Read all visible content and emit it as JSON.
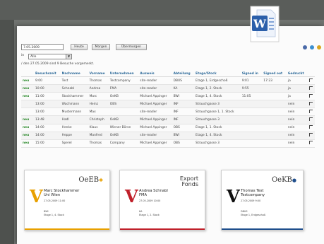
{
  "colors": {
    "badge_v_1": "#e8a000",
    "badge_v_2": "#c0202a",
    "badge_v_3": "#111111",
    "header_link": "#2f6b9a",
    "status_green": "#2c8a2c"
  },
  "icons": [
    "word-icon",
    "print-icon",
    "info-icon",
    "help-icon"
  ],
  "toolbar": {
    "date_value": "7.05.2009",
    "heute_label": "Heute",
    "morgen_label": "Morgen",
    "uebermorgen_label": "Übermorgen",
    "select_prefix": "in",
    "select_value": "Alle",
    "info_text": "/ den 27.05.2009 sind 9 Besuche vorgemerkt."
  },
  "table": {
    "headers": [
      "",
      "Besuchszeit",
      "Nachname",
      "Vorname",
      "Unternehmen",
      "Ausweis",
      "Abteilung",
      "Etage/Stock",
      "Signed in",
      "Signed out",
      "Gedruckt",
      ""
    ],
    "rows": [
      [
        "neu",
        "9:00",
        "Test",
        "Thomas",
        "Testcompany",
        "site-reader",
        "DBUS",
        "Etage 1, Erdgeschoß",
        "9:01",
        "17:23",
        "ja"
      ],
      [
        "neu",
        "10:00",
        "Schnabl",
        "Andrea",
        "FMA",
        "site-reader",
        "KA",
        "Etage 1, 2. Stock",
        "9:55",
        "",
        "ja"
      ],
      [
        "neu",
        "11:00",
        "Stockhammer",
        "Marc",
        "OeKB",
        "Michael Appinger",
        "BWI",
        "Etage 1, 4. Stock",
        "11:05",
        "",
        "ja"
      ],
      [
        "",
        "13:00",
        "Wachmann",
        "Heinz",
        "OBS",
        "Michael Appinger",
        "INF",
        "Strauchgasse 3",
        "",
        "",
        "nein"
      ],
      [
        "",
        "13:00",
        "Mustermann",
        "Max",
        "",
        "site-reader",
        "INF",
        "Strauchgasse 1, 1. Stock",
        "",
        "",
        "nein"
      ],
      [
        "neu",
        "13:48",
        "Hadl",
        "Christoph",
        "OeKB",
        "Michael Appinger",
        "INF",
        "Strauchgasse 3",
        "",
        "",
        "nein"
      ],
      [
        "neu",
        "14:00",
        "Henke",
        "Klaus",
        "Wiener Börse",
        "Michael Appinger",
        "OBS",
        "Etage 1, 1. Stock",
        "",
        "",
        "nein"
      ],
      [
        "neu",
        "14:00",
        "Heppe",
        "Manfred",
        "OeKB",
        "site-reader",
        "BWI",
        "Etage 1, 4. Stock",
        "",
        "",
        "nein"
      ],
      [
        "neu",
        "15:00",
        "Sperel",
        "Thomas",
        "Company",
        "Michael Appinger",
        "OBS",
        "Strauchgasse 3",
        "",
        "",
        "nein"
      ]
    ]
  },
  "badges": [
    {
      "letter": "V",
      "name": "Marc Stockhammer",
      "org": "Uni Wien",
      "datetime": "27.05.2009 11:00",
      "host": "BWI",
      "location": "Etage 1, 4. Stock",
      "logo": "OeEB"
    },
    {
      "letter": "V",
      "name": "Andrea Schnabl",
      "org": "FMA",
      "datetime": "27.05.2009 10:00",
      "host": "KA",
      "location": "Etage 1, 2. Stock",
      "logo": "Export Fonds"
    },
    {
      "letter": "V",
      "name": "Thomas Test",
      "org": "Testcompany",
      "datetime": "27.05.2009 9:00",
      "host": "DBUS",
      "location": "Etage 1, Erdgeschoß",
      "logo": "OeKB"
    }
  ]
}
